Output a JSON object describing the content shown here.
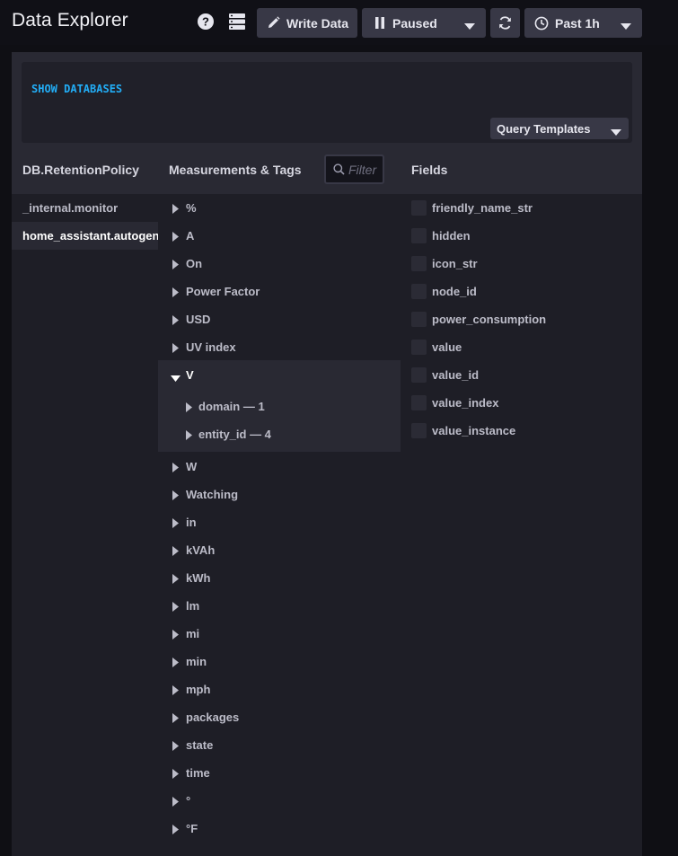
{
  "header": {
    "title": "Data Explorer",
    "write_data_label": "Write Data",
    "paused_label": "Paused",
    "time_range_label": "Past 1h",
    "icons": [
      "help-icon",
      "server-icon",
      "pencil-icon",
      "pause-icon",
      "chevron-down-icon",
      "refresh-icon",
      "clock-icon"
    ]
  },
  "query": {
    "text": "SHOW DATABASES",
    "templates_label": "Query Templates"
  },
  "columns": {
    "db_title": "DB.RetentionPolicy",
    "measurements_title": "Measurements & Tags",
    "filter_placeholder": "Filter",
    "fields_title": "Fields"
  },
  "databases": [
    {
      "label": "_internal.monitor",
      "active": false
    },
    {
      "label": "home_assistant.autogen",
      "active": true
    }
  ],
  "measurements": [
    {
      "label": "%"
    },
    {
      "label": "A"
    },
    {
      "label": "On"
    },
    {
      "label": "Power Factor"
    },
    {
      "label": "USD"
    },
    {
      "label": "UV index"
    },
    {
      "label": "V",
      "expanded": true
    },
    {
      "label": "W"
    },
    {
      "label": "Watching"
    },
    {
      "label": "in"
    },
    {
      "label": "kVAh"
    },
    {
      "label": "kWh"
    },
    {
      "label": "lm"
    },
    {
      "label": "mi"
    },
    {
      "label": "min"
    },
    {
      "label": "mph"
    },
    {
      "label": "packages"
    },
    {
      "label": "state"
    },
    {
      "label": "time"
    },
    {
      "label": "°"
    },
    {
      "label": "°F"
    }
  ],
  "tags": [
    {
      "label": "domain — 1"
    },
    {
      "label": "entity_id — 4"
    }
  ],
  "fields": [
    {
      "label": "friendly_name_str"
    },
    {
      "label": "hidden"
    },
    {
      "label": "icon_str"
    },
    {
      "label": "node_id"
    },
    {
      "label": "power_consumption"
    },
    {
      "label": "value"
    },
    {
      "label": "value_id"
    },
    {
      "label": "value_index"
    },
    {
      "label": "value_instance"
    }
  ],
  "colors": {
    "accent_query": "#22adf6",
    "panel_bg": "#292933",
    "column_bg": "#1e1e26",
    "button_bg": "#383846"
  }
}
